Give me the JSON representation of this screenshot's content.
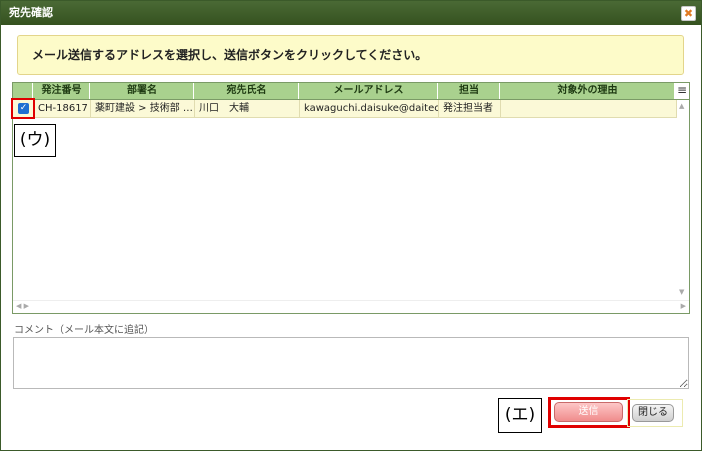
{
  "dialog": {
    "title": "宛先確認",
    "close_icon": "✖"
  },
  "notice": {
    "text": "メール送信するアドレスを選択し、送信ボタンをクリックしてください。"
  },
  "grid": {
    "menu_icon": "≡",
    "columns": [
      "発注番号",
      "部署名",
      "宛先氏名",
      "メールアドレス",
      "担当",
      "対象外の理由"
    ],
    "rows": [
      {
        "checked": true,
        "check_glyph": "✓",
        "cells": [
          "CH-18617",
          "薬町建設 > 技術部 …",
          "川口　大輔",
          "kawaguchi.daisuke@daitec.…",
          "発注担当者",
          ""
        ]
      }
    ],
    "scroll_up": "▲",
    "scroll_down": "▼",
    "hscroll_left": "◀ ▶",
    "hscroll_right": "▶"
  },
  "callouts": {
    "u": "(ウ)",
    "e": "(エ)"
  },
  "comment": {
    "label": "コメント（メール本文に追記）",
    "value": ""
  },
  "buttons": {
    "send": "送信",
    "close": "閉じる"
  }
}
